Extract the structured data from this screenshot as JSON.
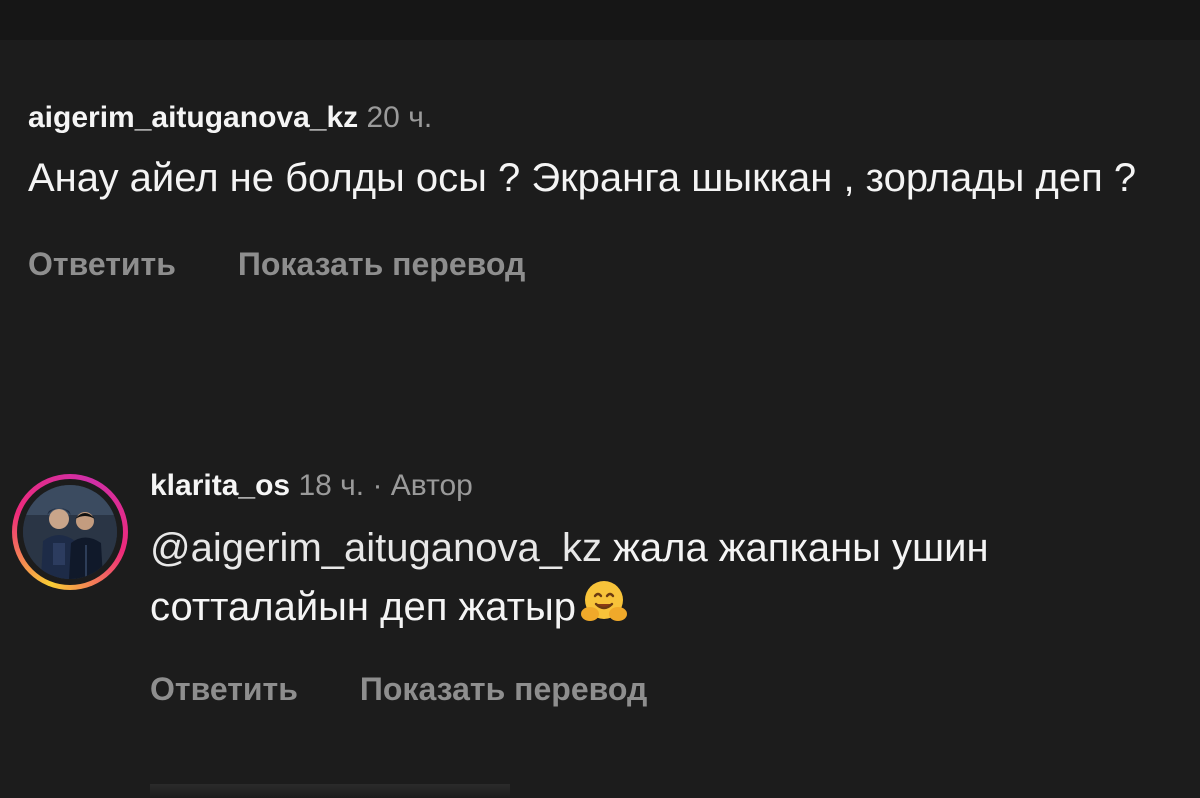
{
  "comments": [
    {
      "username": "aigerim_aituganova_kz",
      "time": "20 ч.",
      "text": "Анау айел не болды осы ? Экранга шыккан , зорлады деп ?",
      "actions": {
        "reply": "Ответить",
        "translate": "Показать перевод"
      }
    },
    {
      "username": "klarita_os",
      "time": "18 ч.",
      "separator": "·",
      "author_badge": "Автор",
      "mention": "@aigerim_aituganova_kz",
      "text": " жала жапканы ушин сотталайын деп жатыр",
      "emoji": "hugging-face",
      "actions": {
        "reply": "Ответить",
        "translate": "Показать перевод"
      }
    }
  ],
  "colors": {
    "background": "#1c1c1c",
    "text": "#f4f4f4",
    "muted": "#9a9a9a",
    "story_ring": [
      "#f9ce34",
      "#ee2a7b",
      "#cf2fa8"
    ]
  }
}
